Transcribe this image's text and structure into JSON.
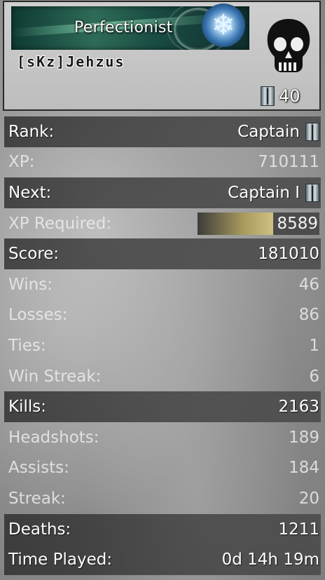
{
  "header": {
    "title": "Perfectionist",
    "gamertag": "[sKz]Jehzus",
    "level": "40",
    "icons": {
      "emblem": "snowflake-emblem-icon",
      "skull": "skull-icon",
      "rank": "captain-bars-icon"
    }
  },
  "stats": {
    "rank": {
      "label": "Rank:",
      "value": "Captain"
    },
    "xp": {
      "label": "XP:",
      "value": "710111"
    },
    "next": {
      "label": "Next:",
      "value": "Captain I"
    },
    "xp_required": {
      "label": "XP Required:",
      "value": "8589",
      "progress": 0.62
    },
    "score": {
      "label": "Score:",
      "value": "181010"
    },
    "wins": {
      "label": "Wins:",
      "value": "46"
    },
    "losses": {
      "label": "Losses:",
      "value": "86"
    },
    "ties": {
      "label": "Ties:",
      "value": "1"
    },
    "win_streak": {
      "label": "Win Streak:",
      "value": "6"
    },
    "kills": {
      "label": "Kills:",
      "value": "2163"
    },
    "headshots": {
      "label": "Headshots:",
      "value": "189"
    },
    "assists": {
      "label": "Assists:",
      "value": "184"
    },
    "streak": {
      "label": "Streak:",
      "value": "20"
    },
    "deaths": {
      "label": "Deaths:",
      "value": "1211"
    },
    "time_played": {
      "label": "Time Played:",
      "value": "0d 14h 19m"
    }
  }
}
